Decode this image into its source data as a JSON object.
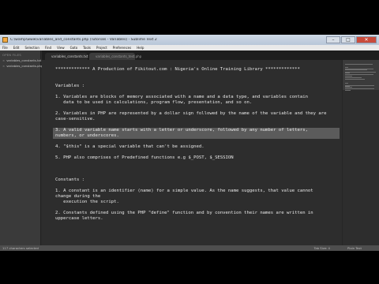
{
  "window": {
    "title": "C:\\wamp\\www\\variables_and_constants.php (Tutorials - Variables) - Sublime Text 2",
    "controls": {
      "minimize": "–",
      "maximize": "□",
      "close": "✕"
    }
  },
  "menu": [
    "File",
    "Edit",
    "Selection",
    "Find",
    "View",
    "Goto",
    "Tools",
    "Project",
    "Preferences",
    "Help"
  ],
  "sidebar": {
    "header": "OPEN FILES",
    "files": [
      "variables_constants.txt",
      "variables_constants.php"
    ]
  },
  "tabs": [
    {
      "label": "variables_constants.txt"
    },
    {
      "label": "variables_constants_test.php"
    }
  ],
  "editor": {
    "lines": [
      "",
      "************* A Production of Fikitout.com : Nigeria's Online Training Library *************",
      "",
      "",
      "Variables :",
      "",
      "1. Variables are blocks of memory associated with a name and a data type, and variables contain",
      "   data to be used in calculations, program flow, presentation, and so on.",
      "",
      "2. Variables in PHP are represented by a dollar sign followed by the name of the variable and they are",
      "case-sensitive.",
      "",
      "3. A valid variable name starts with a letter or underscore, followed by any number of letters,",
      "numbers, or underscores.",
      "",
      "4. \"$this\" is a special variable that can't be assigned.",
      "",
      "5. PHP also comprises of Predefined functions e.g $_POST, $_SESSION",
      "",
      "",
      "",
      "Constants :",
      "",
      "1. A constant is an identifier (name) for a simple value. As the name suggests, that value cannot",
      "change during the",
      "   execution the script.",
      "",
      "2. Constants defined using the PHP \"define\" function and by convention their names are written in",
      "uppercase letters.",
      "",
      "",
      ""
    ],
    "highlighted_lines": [
      12,
      13
    ]
  },
  "status": {
    "left": "117 characters selected",
    "tab_size": "Tab Size: 4",
    "syntax": "Plain Text"
  }
}
